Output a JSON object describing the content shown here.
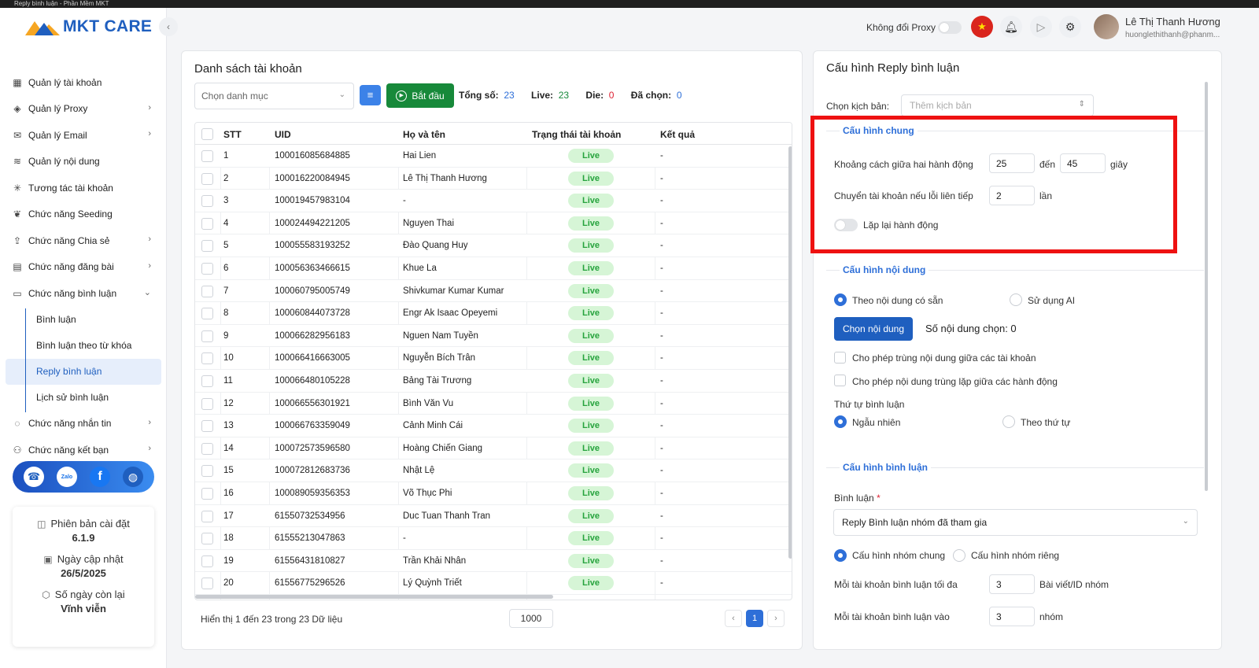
{
  "window": {
    "title": "Reply bình luận - Phần Mềm MKT"
  },
  "app": {
    "logo_text": "MKT CARE"
  },
  "sidebar": {
    "items": [
      {
        "label": "Quản lý tài khoản",
        "icon": "grid-icon",
        "chevron": false
      },
      {
        "label": "Quản lý Proxy",
        "icon": "layers-icon",
        "chevron": true
      },
      {
        "label": "Quản lý Email",
        "icon": "mail-icon",
        "chevron": true
      },
      {
        "label": "Quản lý nội dung",
        "icon": "content-icon",
        "chevron": false
      },
      {
        "label": "Tương tác tài khoản",
        "icon": "sparkle-icon",
        "chevron": false
      },
      {
        "label": "Chức năng Seeding",
        "icon": "seed-icon",
        "chevron": false
      },
      {
        "label": "Chức năng Chia sẻ",
        "icon": "share-icon",
        "chevron": true
      },
      {
        "label": "Chức năng đăng bài",
        "icon": "post-icon",
        "chevron": true
      },
      {
        "label": "Chức năng bình luận",
        "icon": "comment-icon",
        "chevron": true
      }
    ],
    "subitems": [
      {
        "label": "Bình luận"
      },
      {
        "label": "Bình luận theo từ khóa"
      },
      {
        "label": "Reply bình luận",
        "active": true
      },
      {
        "label": "Lịch sử bình luận"
      }
    ],
    "items_after": [
      {
        "label": "Chức năng nhắn tin",
        "icon": "chat-icon"
      },
      {
        "label": "Chức năng kết bạn",
        "icon": "add-friend-icon"
      }
    ],
    "social": {
      "zalo": "Zalo",
      "facebook": "f",
      "globe": "◍",
      "support": "☎"
    },
    "info": {
      "version_label": "Phiên bản cài đặt",
      "version_value": "6.1.9",
      "updated_label": "Ngày cập nhật",
      "updated_value": "26/5/2025",
      "days_label": "Số ngày còn lại",
      "days_value": "Vĩnh viễn"
    }
  },
  "header": {
    "proxy_label": "Không đổi Proxy",
    "user_name": "Lê Thị Thanh Hương",
    "user_email": "huonglethithanh@phanm..."
  },
  "accounts": {
    "title": "Danh sách tài khoản",
    "category_placeholder": "Chọn danh mục",
    "start_label": "Bắt đầu",
    "stats": {
      "total_label": "Tổng số:",
      "total": "23",
      "live_label": "Live:",
      "live": "23",
      "die_label": "Die:",
      "die": "0",
      "selected_label": "Đã chọn:",
      "selected": "0"
    },
    "columns": [
      "STT",
      "UID",
      "Họ và tên",
      "Trạng thái tài khoản",
      "Kết quả"
    ],
    "rows": [
      {
        "stt": "1",
        "uid": "100016085684885",
        "name": "Hai Lien",
        "status": "Live",
        "result": "-"
      },
      {
        "stt": "2",
        "uid": "100016220084945",
        "name": "Lê Thị Thanh Hương",
        "status": "Live",
        "result": "-"
      },
      {
        "stt": "3",
        "uid": "100019457983104",
        "name": "-",
        "status": "Live",
        "result": "-"
      },
      {
        "stt": "4",
        "uid": "100024494221205",
        "name": "Nguyen Thai",
        "status": "Live",
        "result": "-"
      },
      {
        "stt": "5",
        "uid": "100055583193252",
        "name": "Đào Quang Huy",
        "status": "Live",
        "result": "-"
      },
      {
        "stt": "6",
        "uid": "100056363466615",
        "name": "Khue La",
        "status": "Live",
        "result": "-"
      },
      {
        "stt": "7",
        "uid": "100060795005749",
        "name": "Shivkumar Kumar Kumar",
        "status": "Live",
        "result": "-"
      },
      {
        "stt": "8",
        "uid": "100060844073728",
        "name": "Engr Ak Isaac Opeyemi",
        "status": "Live",
        "result": "-"
      },
      {
        "stt": "9",
        "uid": "100066282956183",
        "name": "Nguen Nam Tuyền",
        "status": "Live",
        "result": "-"
      },
      {
        "stt": "10",
        "uid": "100066416663005",
        "name": "Nguyễn Bích Trân",
        "status": "Live",
        "result": "-"
      },
      {
        "stt": "11",
        "uid": "100066480105228",
        "name": "Bảng Tài Trương",
        "status": "Live",
        "result": "-"
      },
      {
        "stt": "12",
        "uid": "100066556301921",
        "name": "Bình Văn Vu",
        "status": "Live",
        "result": "-"
      },
      {
        "stt": "13",
        "uid": "100066763359049",
        "name": "Cảnh Minh Cái",
        "status": "Live",
        "result": "-"
      },
      {
        "stt": "14",
        "uid": "100072573596580",
        "name": "Hoàng Chiến Giang",
        "status": "Live",
        "result": "-"
      },
      {
        "stt": "15",
        "uid": "100072812683736",
        "name": "Nhật Lệ",
        "status": "Live",
        "result": "-"
      },
      {
        "stt": "16",
        "uid": "100089059356353",
        "name": "Võ Thục Phi",
        "status": "Live",
        "result": "-"
      },
      {
        "stt": "17",
        "uid": "61550732534956",
        "name": "Duc Tuan Thanh Tran",
        "status": "Live",
        "result": "-"
      },
      {
        "stt": "18",
        "uid": "61555213047863",
        "name": "-",
        "status": "Live",
        "result": "-"
      },
      {
        "stt": "19",
        "uid": "61556431810827",
        "name": "Trần Khải Nhân",
        "status": "Live",
        "result": "-"
      },
      {
        "stt": "20",
        "uid": "61556775296526",
        "name": "Lý Quỳnh Triết",
        "status": "Live",
        "result": "-"
      }
    ],
    "footer": "Hiển thị 1 đến 23 trong 23 Dữ liệu",
    "page_size": "1000",
    "current_page": "1",
    "prev": "‹",
    "next": "›"
  },
  "config": {
    "title": "Cấu hình Reply bình luận",
    "script_label": "Chọn kịch bản:",
    "script_placeholder": "Thêm kịch bản",
    "general": {
      "heading": "Cấu hình chung",
      "interval_label": "Khoảng cách giữa hai hành động",
      "interval_from": "25",
      "to_label": "đến",
      "interval_to": "45",
      "seconds": "giây",
      "switch_label": "Chuyển tài khoản nếu lỗi liên tiếp",
      "switch_value": "2",
      "times": "lần",
      "repeat_label": "Lặp lại hành động"
    },
    "content": {
      "heading": "Cấu hình nội dung",
      "opt_existing": "Theo nội dung có sẵn",
      "opt_ai": "Sử dụng AI",
      "choose_btn": "Chọn nội dung",
      "count_text": "Số nội dung chọn: 0",
      "chk_dup_accounts": "Cho phép trùng nội dung giữa các tài khoản",
      "chk_dup_actions": "Cho phép nội dung trùng lặp giữa các hành động",
      "order_label": "Thứ tự bình luận",
      "order_random": "Ngẫu nhiên",
      "order_seq": "Theo thứ tự"
    },
    "comment": {
      "heading": "Cấu hình bình luận",
      "comment_label": "Bình luận",
      "required_mark": "*",
      "comment_value": "Reply Bình luận nhóm đã tham gia",
      "group_common": "Cấu hình nhóm chung",
      "group_private": "Cấu hình nhóm riêng",
      "max_label": "Mỗi tài khoản bình luận tối đa",
      "max_value": "3",
      "max_unit": "Bài viết/ID nhóm",
      "groups_label": "Mỗi tài khoản bình luận vào",
      "groups_value": "3",
      "groups_unit": "nhóm"
    }
  },
  "colors": {
    "primary": "#1f5fbf",
    "start": "#17893a",
    "live_bg": "#d6f5d6",
    "live_fg": "#26a33d",
    "highlight": "#ee1111"
  }
}
